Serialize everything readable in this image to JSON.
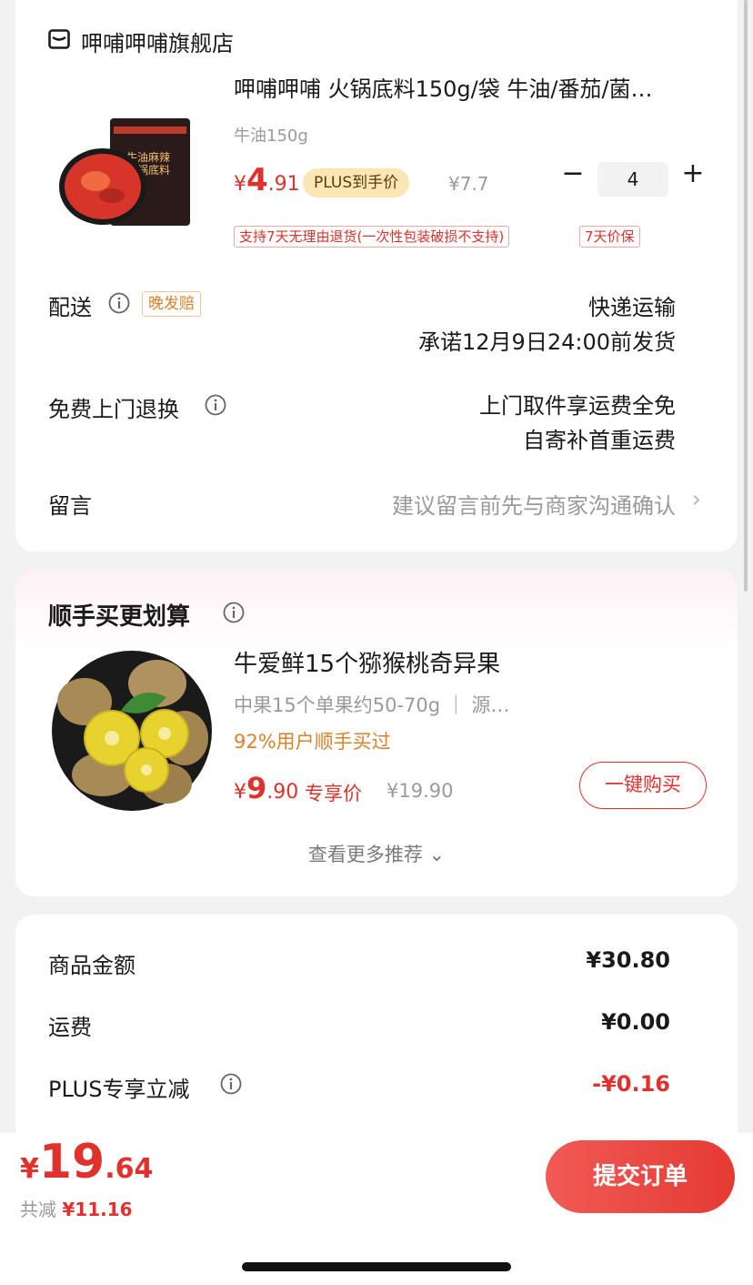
{
  "store": {
    "name": "呷哺呷哺旗舰店",
    "icon": "store-icon"
  },
  "product": {
    "title": "呷哺呷哺 火锅底料150g/袋 牛油/番茄/菌…",
    "spec": "牛油150g",
    "price_yen": "¥",
    "price_int": "4",
    "price_dec": ".91",
    "plus_label": "PLUS到手价",
    "old_price": "¥7.7",
    "quantity": "4",
    "minus_symbol": "−",
    "plus_symbol": "+",
    "tags": [
      "支持7天无理由退货(一次性包装破损不支持)",
      "7天价保"
    ]
  },
  "delivery": {
    "label": "配送",
    "badge": "晚发赔",
    "method": "快递运输",
    "promise": "承诺12月9日24:00前发货"
  },
  "returns": {
    "label": "免费上门退换",
    "line1": "上门取件享运费全免",
    "line2": "自寄补首重运费"
  },
  "message": {
    "label": "留言",
    "placeholder": "建议留言前先与商家沟通确认",
    "chevron": "›"
  },
  "addon": {
    "title": "顺手买更划算",
    "product_title": "牛爱鲜15个猕猴桃奇异果",
    "spec": "中果15个单果约50-70g ｜ 源…",
    "social": "92%用户顺手买过",
    "price_yen": "¥",
    "price_int": "9",
    "price_dec": ".90",
    "price_label": "专享价",
    "old_price": "¥19.90",
    "buy_label": "一键购买",
    "more_label": "查看更多推荐 ⌄"
  },
  "summary": {
    "rows": [
      {
        "label": "商品金额",
        "value": "¥30.80"
      },
      {
        "label": "运费",
        "value": "¥0.00"
      },
      {
        "label": "PLUS专享立减",
        "value": "-¥0.16"
      }
    ]
  },
  "footer": {
    "total_yen": "¥",
    "total_int": "19",
    "total_dec": ".64",
    "saved_label": "共减",
    "saved_amount": "¥11.16",
    "submit_label": "提交订单"
  },
  "colors": {
    "accent": "#e0312c",
    "plus_badge": "#fbe6b4",
    "orange": "#d9822b"
  }
}
